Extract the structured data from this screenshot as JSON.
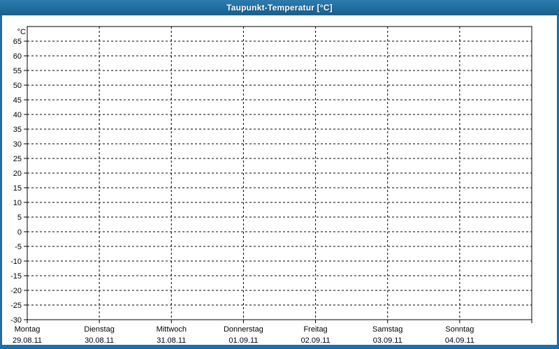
{
  "window": {
    "title": "Taupunkt-Temperatur [°C]",
    "colors": {
      "titlebar_top": "#2c7cb0",
      "titlebar_bottom": "#17608f",
      "border": "#1d6fa5",
      "background": "#ffffff",
      "text": "#000000",
      "grid": "#000000"
    }
  },
  "chart_data": {
    "type": "line",
    "title": "Taupunkt-Temperatur [°C]",
    "ylabel": "°C",
    "ylim": [
      -30,
      70
    ],
    "y_tick_step": 5,
    "y_tick_labels": [
      "65",
      "60",
      "55",
      "50",
      "45",
      "40",
      "35",
      "30",
      "25",
      "20",
      "15",
      "10",
      "5",
      "0",
      "-5",
      "-10",
      "-15",
      "-20",
      "-25",
      "-30"
    ],
    "x_axis": {
      "days": [
        {
          "label": "Montag",
          "date": "29.08.11"
        },
        {
          "label": "Dienstag",
          "date": "30.08.11"
        },
        {
          "label": "Mittwoch",
          "date": "31.08.11"
        },
        {
          "label": "Donnerstag",
          "date": "01.09.11"
        },
        {
          "label": "Freitag",
          "date": "02.09.11"
        },
        {
          "label": "Samstag",
          "date": "03.09.11"
        },
        {
          "label": "Sonntag",
          "date": "04.09.11"
        }
      ]
    },
    "grid": "dashed",
    "legend": "none",
    "series": []
  }
}
